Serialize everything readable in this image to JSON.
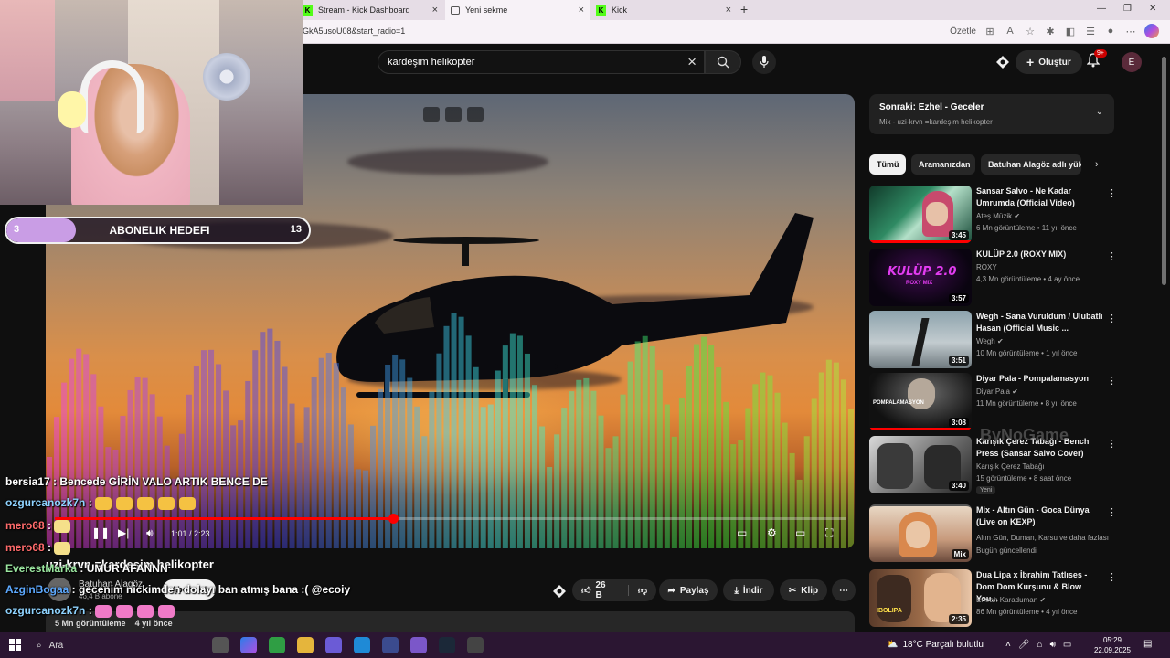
{
  "browser": {
    "tabs": [
      {
        "label": "Stream - Kick Dashboard",
        "favicon": "kick-icon"
      },
      {
        "label": "Yeni sekme",
        "favicon": "blank-page-icon"
      },
      {
        "label": "Kick",
        "favicon": "kick-icon"
      }
    ],
    "url": "GkA5usoU08&start_radio=1",
    "summarize_label": "Özetle"
  },
  "youtube": {
    "search_query": "kardeşim helikopter",
    "create_label": "Oluştur",
    "notification_count": "9+",
    "avatar_letter": "E",
    "player": {
      "time": "1:01 / 2:23",
      "progress": 0.427
    },
    "video": {
      "title": "uzi-krvn =kardeşim helikopter",
      "channel": "Batuhan Alagöz",
      "subscribers": "46,4 B abone",
      "subscribe_label": "Abone ol",
      "likes": "26 B",
      "share_label": "Paylaş",
      "download_label": "İndir",
      "clip_label": "Klip",
      "views": "5 Mn görüntüleme",
      "age": "4 yıl önce"
    },
    "up_next": {
      "title": "Sonraki: Ezhel - Geceler",
      "subtitle": "Mix - uzi-krvn =kardeşim helikopter"
    },
    "chips": [
      {
        "label": "Tümü",
        "active": true
      },
      {
        "label": "Aramanızdan",
        "active": false
      },
      {
        "label": "Batuhan Alagöz adlı yük",
        "active": false
      }
    ],
    "recommendations": [
      {
        "title": "Sansar Salvo - Ne Kadar Umrumda (Official Video)",
        "channel": "Ateş Müzik",
        "meta": "6 Mn görüntüleme • 11 yıl önce",
        "duration": "3:45"
      },
      {
        "title": "KULÜP 2.0 (ROXY MIX)",
        "channel": "ROXY",
        "meta": "4,3 Mn görüntüleme • 4 ay önce",
        "duration": "3:57"
      },
      {
        "title": "Wegh - Sana Vuruldum / Ulubatlı Hasan (Official Music ...",
        "channel": "Wegh",
        "meta": "10 Mn görüntüleme • 1 yıl önce",
        "duration": "3:51"
      },
      {
        "title": "Diyar Pala - Pompalamasyon",
        "channel": "Diyar Pala",
        "meta": "11 Mn görüntüleme • 8 yıl önce",
        "duration": "3:08"
      },
      {
        "title": "Karışık Çerez Tabağı - Bench Press (Sansar Salvo Cover)",
        "channel": "Karışık Çerez Tabağı",
        "meta": "15 görüntüleme • 8 saat önce",
        "duration": "3:40",
        "badge": "Yeni"
      },
      {
        "title": "Mix - Altın Gün - Goca Dünya (Live on KEXP)",
        "channel": "Altın Gün, Duman, Karsu ve daha fazlası",
        "meta": "Bugün güncellendi",
        "duration": "Mix"
      },
      {
        "title": "Dua Lipa x İbrahim Tatlıses - Dom Dom Kurşunu & Blow You...",
        "channel": "Emrah Karaduman",
        "meta": "86 Mn görüntüleme • 4 yıl önce",
        "duration": "2:35"
      }
    ]
  },
  "stream_overlay": {
    "goal": {
      "current": "3",
      "title": "ABONELIK HEDEFI",
      "target": "13",
      "fraction": 0.23
    },
    "chat": [
      {
        "user": "bersia17",
        "message": "Bencede GİRİN VALO ARTIK BENCE DE",
        "color": "#ffffff"
      },
      {
        "user": "ozgurcanozk7n",
        "message": "",
        "color": "#8fd3ff",
        "emotes": 5
      },
      {
        "user": "mero68",
        "message": "",
        "color": "#ff6b6b",
        "emotes": 1
      },
      {
        "user": "mero68",
        "message": "",
        "color": "#ff6b6b",
        "emotes": 1
      },
      {
        "user": "EverestMarka",
        "message": "UMUR AFANNN",
        "color": "#9be7a0"
      },
      {
        "user": "AzginBogaa",
        "message": "gecenim nickimden dolayı ban atmış bana :( @ecoiy",
        "color": "#5da9ff"
      },
      {
        "user": "ozgurcanozk7n",
        "message": "",
        "color": "#8fd3ff",
        "emotes": 4
      }
    ],
    "watermark": "ByNoGame"
  },
  "taskbar": {
    "search_label": "Ara",
    "weather": "18°C  Parçalı bulutlu",
    "time": "05:29",
    "date": "22.09.2025"
  }
}
